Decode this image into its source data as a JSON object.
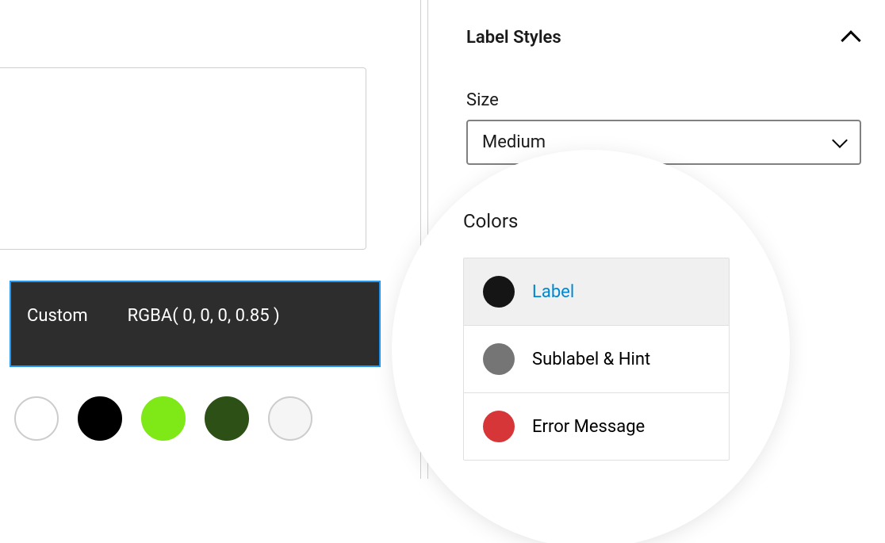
{
  "section": {
    "title": "Label Styles"
  },
  "size": {
    "label": "Size",
    "value": "Medium"
  },
  "custom": {
    "label": "Custom",
    "value": "RGBA( 0, 0, 0, 0.85 )"
  },
  "swatches": {
    "white": "#ffffff",
    "black": "#000000",
    "lime": "#7FE817",
    "darkgreen": "#2d5016",
    "lightgray": "#f5f5f5"
  },
  "colors": {
    "heading": "Colors",
    "items": [
      {
        "name": "Label",
        "color": "#151515",
        "selected": true
      },
      {
        "name": "Sublabel & Hint",
        "color": "#757575",
        "selected": false
      },
      {
        "name": "Error Message",
        "color": "#d63638",
        "selected": false
      }
    ]
  }
}
